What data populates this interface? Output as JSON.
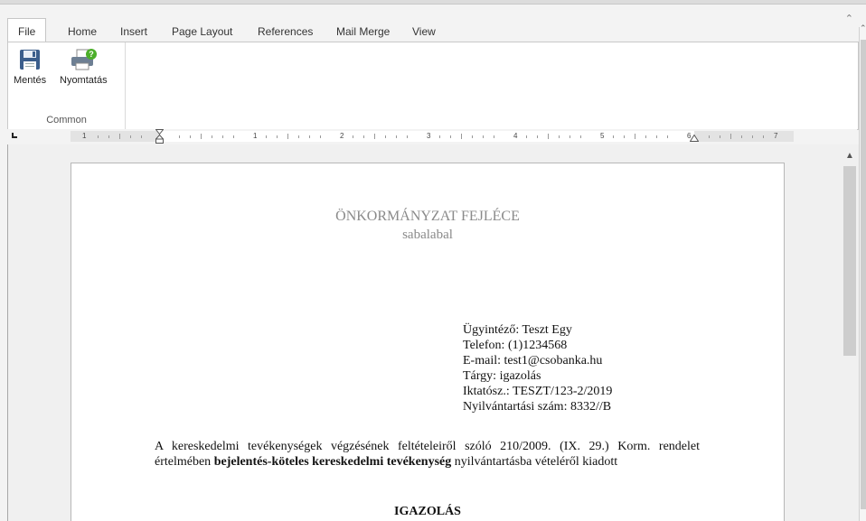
{
  "ribbon": {
    "tabs": [
      "File",
      "Home",
      "Insert",
      "Page Layout",
      "References",
      "Mail Merge",
      "View"
    ],
    "active_tab": "File",
    "group_label": "Common",
    "buttons": {
      "save": "Mentés",
      "print": "Nyomtatás"
    }
  },
  "ruler": {
    "numbers": [
      "1",
      "1",
      "2",
      "3",
      "4",
      "5",
      "6",
      "7"
    ]
  },
  "document": {
    "header_title": "ÖNKORMÁNYZAT FEJLÉCE",
    "header_subtitle": "sabalabal",
    "meta": [
      "Ügyintéző: Teszt Egy",
      "Telefon: (1)1234568",
      "E-mail: test1@csobanka.hu",
      "Tárgy: igazolás",
      "Iktatósz.: TESZT/123-2/2019",
      "Nyilvántartási szám: 8332//B"
    ],
    "body_intro": "A kereskedelmi tevékenységek végzésének feltételeiről szóló 210/2009. (IX. 29.) Korm. rendelet értelmében",
    "body_bold": "bejelentés-köteles kereskedelmi tevékenység",
    "body_outro": "nyilvántartásba vételéről kiadott",
    "section_title": "IGAZOLÁS"
  }
}
